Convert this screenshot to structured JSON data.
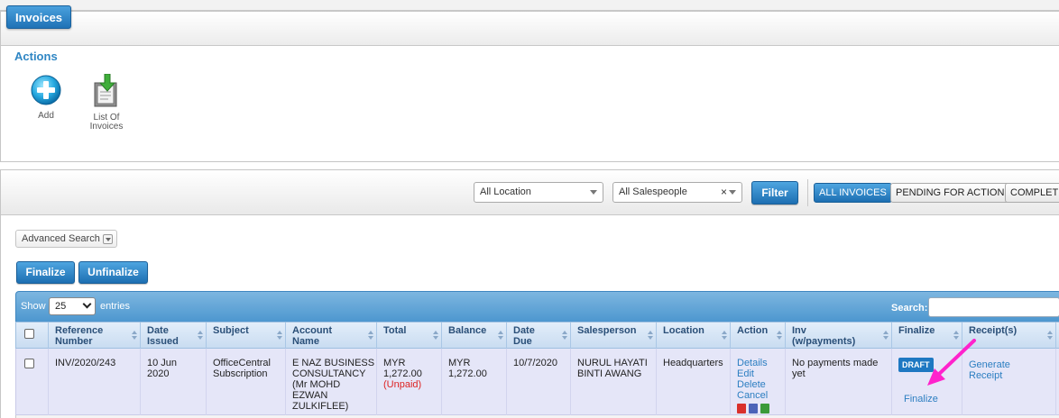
{
  "page": {
    "title": "Invoices"
  },
  "actions": {
    "heading": "Actions",
    "add_label": "Add",
    "list_label_line1": "List Of",
    "list_label_line2": "Invoices"
  },
  "filters": {
    "location": "All Location",
    "salesperson": "All Salespeople",
    "clear_symbol": "×",
    "filter_button": "Filter",
    "tabs": [
      "ALL INVOICES",
      "PENDING FOR ACTION",
      "COMPLETED"
    ],
    "active_tab": "ALL INVOICES"
  },
  "advanced_search": "Advanced Search",
  "bulk": {
    "finalize": "Finalize",
    "unfinalize": "Unfinalize"
  },
  "table_controls": {
    "show": "Show",
    "page_length": "25",
    "entries": "entries",
    "search_label": "Search:"
  },
  "columns": [
    {
      "l1": "Reference",
      "l2": "Number"
    },
    {
      "l1": "Date",
      "l2": "Issued"
    },
    {
      "l1": "Subject",
      "l2": ""
    },
    {
      "l1": "Account",
      "l2": "Name"
    },
    {
      "l1": "Total",
      "l2": ""
    },
    {
      "l1": "Balance",
      "l2": ""
    },
    {
      "l1": "Date",
      "l2": "Due"
    },
    {
      "l1": "Salesperson",
      "l2": ""
    },
    {
      "l1": "Location",
      "l2": ""
    },
    {
      "l1": "Action",
      "l2": ""
    },
    {
      "l1": "Inv",
      "l2": "(w/payments)"
    },
    {
      "l1": "Finalize",
      "l2": ""
    },
    {
      "l1": "Receipt(s)",
      "l2": ""
    }
  ],
  "rows": [
    {
      "ref": "INV/2020/243",
      "date_issued_l1": "10 Jun",
      "date_issued_l2": "2020",
      "subject_l1": "OfficeCentral",
      "subject_l2": "Subscription",
      "account_lines": [
        "E NAZ BUSINESS",
        "CONSULTANCY",
        "(Mr MOHD",
        "EZWAN",
        "ZULKIFLEE)"
      ],
      "total_currency": "MYR",
      "total_amount": "1,272.00",
      "total_status": "(Unpaid)",
      "balance_currency": "MYR",
      "balance_amount": "1,272.00",
      "date_due": "10/7/2020",
      "salesperson_l1": "NURUL HAYATI",
      "salesperson_l2": "BINTI AWANG",
      "location": "Headquarters",
      "actions": [
        "Details",
        "Edit",
        "Delete",
        "Cancel"
      ],
      "inv_payments_l1": "No payments made",
      "inv_payments_l2": "yet",
      "finalize_badge": "DRAFT",
      "finalize_link": "Finalize",
      "receipt_l1": "Generate",
      "receipt_l2": "Receipt"
    }
  ],
  "colors": {
    "accent": "#1d6fb2",
    "link": "#2b7ec1",
    "unpaid": "#dd2222",
    "arrow": "#ff22cc",
    "row_bg": "#e5e6f8"
  }
}
